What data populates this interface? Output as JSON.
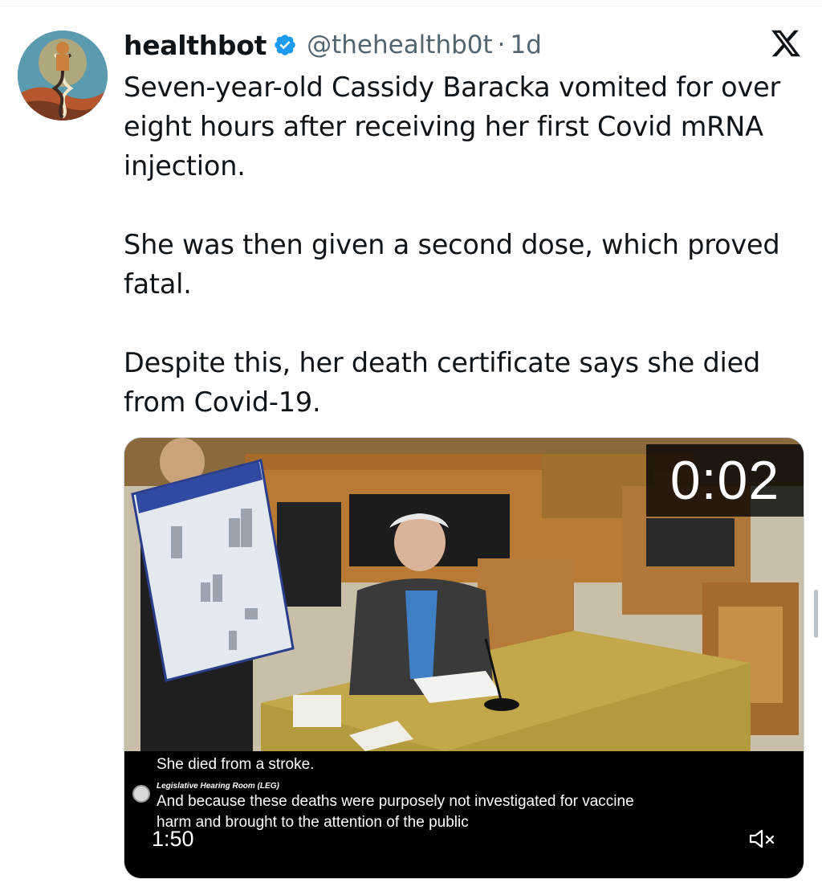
{
  "tweet": {
    "display_name": "healthbot",
    "handle": "@thehealthb0t",
    "separator": "·",
    "time": "1d",
    "text_paragraphs": [
      "Seven-year-old Cassidy Baracka vomited for over eight hours after receiving her first Covid mRNA injection.",
      "She was then given a second dose, which proved fatal.",
      "Despite this, her death certificate says she died from Covid-19."
    ]
  },
  "video": {
    "timer_overlay": "0:02",
    "caption_line_1": "She died from a stroke.",
    "caption_room": "Legislative Hearing Room (LEG)",
    "caption_line_2": "And because these deaths were purposely not investigated for vaccine",
    "caption_line_3": "harm and brought to the attention of the public",
    "duration": "1:50"
  },
  "colors": {
    "text_primary": "#0f1419",
    "text_secondary": "#536471",
    "verified_blue": "#1d9bf0"
  },
  "icons": {
    "verified": "verified-badge-icon",
    "x_logo": "x-logo-icon",
    "mute": "mute-icon"
  }
}
